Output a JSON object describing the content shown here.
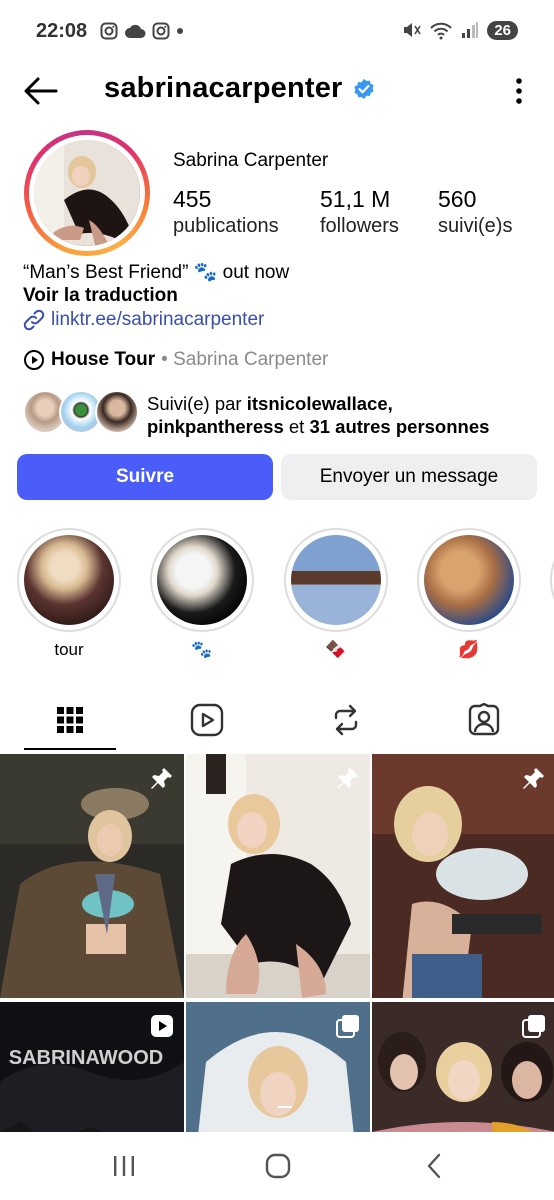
{
  "status_bar": {
    "time": "22:08",
    "battery": "26",
    "icons_left": [
      "instagram-icon",
      "cloud-icon",
      "instagram-icon",
      "dot-icon"
    ],
    "icons_right": [
      "mute-icon",
      "wifi-icon",
      "signal-icon"
    ]
  },
  "header": {
    "username": "sabrinacarpenter",
    "verified": true,
    "back_icon": "arrow-left-icon",
    "more_icon": "more-vertical-icon"
  },
  "profile": {
    "full_name": "Sabrina Carpenter",
    "stats": [
      {
        "value": "455",
        "label": "publications"
      },
      {
        "value": "51,1 M",
        "label": "followers"
      },
      {
        "value": "560",
        "label": "suivi(e)s"
      }
    ],
    "bio_line": "“Man’s Best Friend” 🐾 out now",
    "translate": "Voir la traduction",
    "link": "linktr.ee/sabrinacarpenter",
    "music_title": "House Tour",
    "music_artist": "• Sabrina Carpenter",
    "followed_prefix": "Suivi(e) par ",
    "followed_user1": "itsnicolewallace,",
    "followed_user2": "pinkpantheress",
    "followed_mid": " et ",
    "followed_rest": "31 autres personnes"
  },
  "actions": {
    "follow": "Suivre",
    "message": "Envoyer un message"
  },
  "highlights": [
    {
      "label": "tour"
    },
    {
      "label": "🐾"
    },
    {
      "label": "🍫"
    },
    {
      "label": "💋"
    }
  ],
  "tabs": [
    "grid-icon",
    "reels-icon",
    "reposts-icon",
    "tagged-icon"
  ],
  "grid_posts": [
    {
      "badge": "pin-icon"
    },
    {
      "badge": "pin-icon"
    },
    {
      "badge": "pin-icon"
    },
    {
      "badge": "reel-icon",
      "overlay_text": "SABRINAWOOD"
    },
    {
      "badge": "carousel-icon"
    },
    {
      "badge": "carousel-icon"
    }
  ],
  "navbar": [
    "recents-icon",
    "home-icon",
    "back-icon"
  ]
}
